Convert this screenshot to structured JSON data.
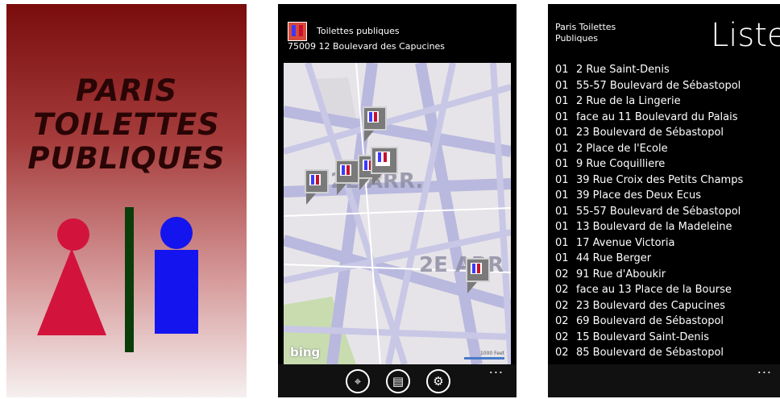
{
  "splash": {
    "title_lines": [
      "PARIS",
      "TOILETTES",
      "PUBLIQUES"
    ],
    "colors": {
      "background_top": "#7a0c0c",
      "women": "#d2143c",
      "divider": "#0b3d0b",
      "men": "#1414ee"
    }
  },
  "map_screen": {
    "title": "Toilettes publiques",
    "address": "75009  12 Boulevard des Capucines",
    "arr_labels": [
      "2E ARR.",
      "2E ARR"
    ],
    "bing_logo": "bing",
    "scale_text": "1000 Feet",
    "app_bar": {
      "buttons": [
        {
          "icon": "locate-icon",
          "glyph": "⌖"
        },
        {
          "icon": "list-icon",
          "glyph": "▤"
        },
        {
          "icon": "settings-icon",
          "glyph": "⚙"
        }
      ],
      "more": "..."
    }
  },
  "list_screen": {
    "app_title": "Paris Toilettes\nPubliques",
    "header": "Liste",
    "items": [
      {
        "code": "01",
        "address": "2 Rue Saint-Denis"
      },
      {
        "code": "01",
        "address": "55-57 Boulevard de Sébastopol"
      },
      {
        "code": "01",
        "address": "2 Rue de la Lingerie"
      },
      {
        "code": "01",
        "address": "face au 11 Boulevard du Palais"
      },
      {
        "code": "01",
        "address": "23 Boulevard de Sébastopol"
      },
      {
        "code": "01",
        "address": "2 Place de l'Ecole"
      },
      {
        "code": "01",
        "address": "9 Rue Coquilliere"
      },
      {
        "code": "01",
        "address": "39 Rue Croix des Petits Champs"
      },
      {
        "code": "01",
        "address": "39 Place des Deux Ecus"
      },
      {
        "code": "01",
        "address": "55-57 Boulevard de Sébastopol"
      },
      {
        "code": "01",
        "address": "13 Boulevard de la Madeleine"
      },
      {
        "code": "01",
        "address": "17 Avenue Victoria"
      },
      {
        "code": "01",
        "address": "44 Rue Berger"
      },
      {
        "code": "02",
        "address": "91 Rue d'Aboukir"
      },
      {
        "code": "02",
        "address": "face au 13 Place de la Bourse"
      },
      {
        "code": "02",
        "address": "23 Boulevard des Capucines"
      },
      {
        "code": "02",
        "address": "69 Boulevard de Sébastopol"
      },
      {
        "code": "02",
        "address": "15 Boulevard Saint-Denis"
      },
      {
        "code": "02",
        "address": "85 Boulevard de Sébastopol"
      }
    ],
    "more": "..."
  }
}
